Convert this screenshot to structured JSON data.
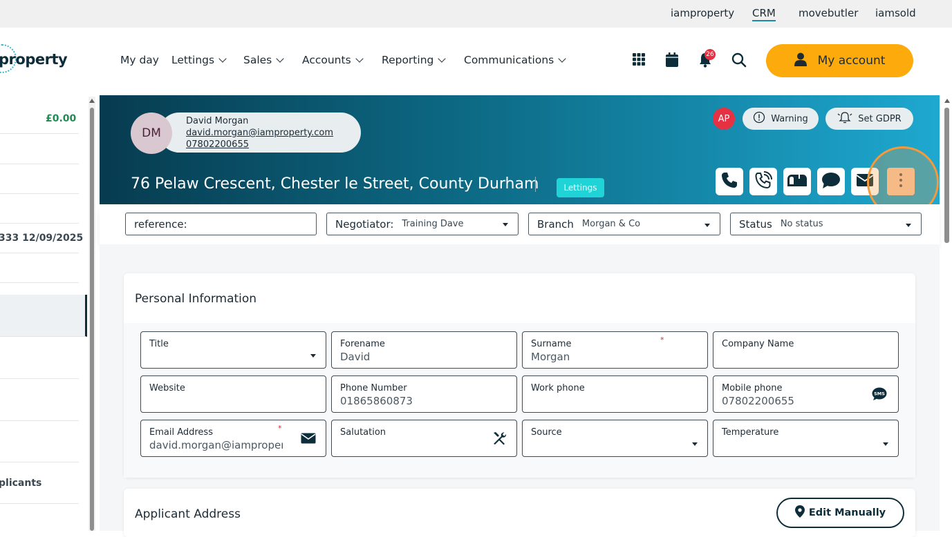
{
  "topbar": {
    "links": [
      "iamproperty",
      "CRM",
      "movebutler",
      "iamsold"
    ],
    "active": "CRM"
  },
  "logo": {
    "text": "property"
  },
  "nav": {
    "items": [
      {
        "label": "My day"
      },
      {
        "label": "Lettings"
      },
      {
        "label": "Sales"
      },
      {
        "label": "Accounts"
      },
      {
        "label": "Reporting"
      },
      {
        "label": "Communications"
      }
    ],
    "notification_count": "26",
    "my_account_label": "My account"
  },
  "sidebar": {
    "balance": "£0.00",
    "date_text": "333 12/09/2025",
    "applicants_text": "plicants"
  },
  "contact": {
    "initials": "DM",
    "name": "David Morgan",
    "email": "david.morgan@iamproperty.com",
    "phone": "07802200655"
  },
  "property": {
    "address": "76 Pelaw Crescent, Chester le Street, County Durham",
    "tag": "Lettings"
  },
  "header": {
    "user_initials": "AP",
    "warning_label": "Warning",
    "gdpr_label": "Set GDPR"
  },
  "filters": {
    "reference": {
      "label": "reference:",
      "value": ""
    },
    "negotiator": {
      "label": "Negotiator:",
      "value": "Training Dave"
    },
    "branch": {
      "label": "Branch",
      "value": "Morgan & Co"
    },
    "status": {
      "label": "Status",
      "value": "No status"
    }
  },
  "personal_info": {
    "title": "Personal Information",
    "fields": {
      "title": {
        "label": "Title",
        "value": ""
      },
      "forename": {
        "label": "Forename",
        "value": "David"
      },
      "surname": {
        "label": "Surname",
        "value": "Morgan"
      },
      "company": {
        "label": "Company Name",
        "value": ""
      },
      "website": {
        "label": "Website",
        "value": ""
      },
      "phone": {
        "label": "Phone Number",
        "value": "01865860873"
      },
      "work_phone": {
        "label": "Work phone",
        "value": ""
      },
      "mobile": {
        "label": "Mobile phone",
        "value": "07802200655"
      },
      "email": {
        "label": "Email Address",
        "value": "david.morgan@iamproperty.com"
      },
      "salutation": {
        "label": "Salutation",
        "value": ""
      },
      "source": {
        "label": "Source",
        "value": ""
      },
      "temperature": {
        "label": "Temperature",
        "value": ""
      }
    },
    "required_mark": "*"
  },
  "applicant_address": {
    "title": "Applicant Address",
    "edit_label": "Edit Manually"
  },
  "colors": {
    "accent": "#fcaa0c",
    "header_dark": "#073b4f",
    "header_light": "#1ea8d0",
    "tag": "#1fd3d6",
    "highlight": "#f39a3c",
    "badge": "#e53142"
  }
}
